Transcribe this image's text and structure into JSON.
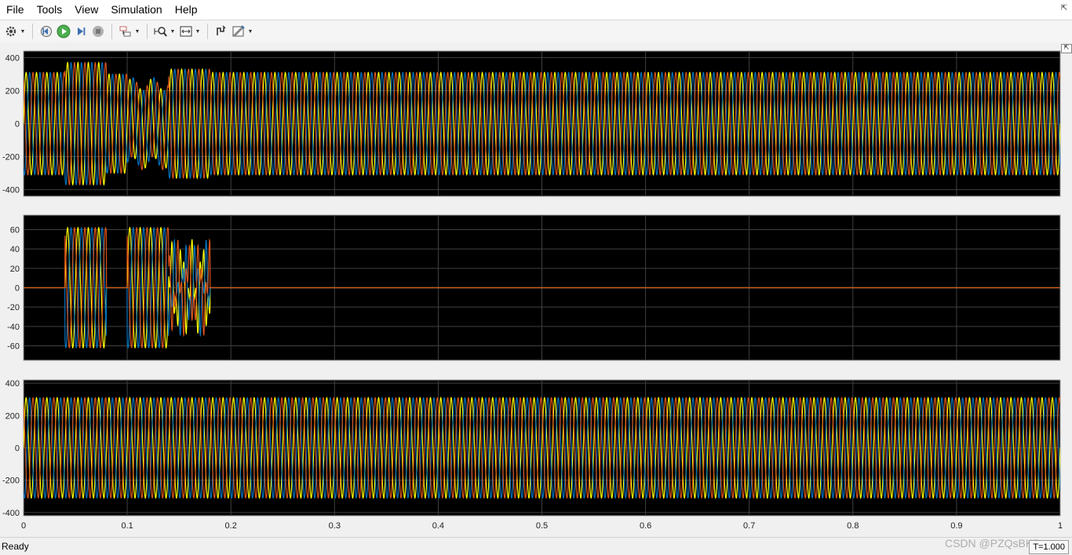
{
  "menubar": {
    "items": [
      {
        "name": "menu-file",
        "label": "File"
      },
      {
        "name": "menu-tools",
        "label": "Tools"
      },
      {
        "name": "menu-view",
        "label": "View"
      },
      {
        "name": "menu-simulation",
        "label": "Simulation"
      },
      {
        "name": "menu-help",
        "label": "Help"
      }
    ]
  },
  "toolbar": {
    "buttons": [
      "configuration-properties-icon",
      "step-back-icon",
      "run-icon",
      "step-forward-icon",
      "stop-icon",
      "highlight-signal-icon",
      "zoom-icon",
      "autoscale-icon",
      "style-icon",
      "cursor-measurements-icon"
    ]
  },
  "status": {
    "text": "Ready",
    "time": "T=1.000"
  },
  "watermark": "CSDN @PZQsBKDawn",
  "colors": {
    "plot_bg": "#000000",
    "grid": "#404040",
    "phase_a": "#ffff00",
    "phase_b": "#0072bd",
    "phase_c": "#d95319"
  },
  "chart_data": [
    {
      "type": "line",
      "title": "",
      "xlabel": "",
      "ylabel": "",
      "xlim": [
        0,
        1
      ],
      "ylim": [
        -440,
        440
      ],
      "yticks": [
        400,
        200,
        0,
        -200,
        -400
      ],
      "grid": true,
      "frequency_hz": 100,
      "series": [
        {
          "phase_deg": 0,
          "color": "#ffff00"
        },
        {
          "phase_deg": -120,
          "color": "#0072bd"
        },
        {
          "phase_deg": 120,
          "color": "#d95319"
        }
      ],
      "segments": [
        {
          "t0": 0.0,
          "t1": 0.04,
          "amplitude": 310
        },
        {
          "t0": 0.04,
          "t1": 0.08,
          "amplitude": 370
        },
        {
          "t0": 0.08,
          "t1": 0.1,
          "amplitude": 300
        },
        {
          "t0": 0.1,
          "t1": 0.14,
          "amplitude": 240
        },
        {
          "t0": 0.14,
          "t1": 0.18,
          "amplitude": 330
        },
        {
          "t0": 0.18,
          "t1": 1.0,
          "amplitude": 310
        }
      ]
    },
    {
      "type": "line",
      "title": "",
      "xlabel": "",
      "ylabel": "",
      "xlim": [
        0,
        1
      ],
      "ylim": [
        -75,
        75
      ],
      "yticks": [
        60,
        40,
        20,
        0,
        -20,
        -40,
        -60
      ],
      "grid": true,
      "frequency_hz": 100,
      "series": [
        {
          "phase_deg": 0,
          "color": "#ffff00"
        },
        {
          "phase_deg": -120,
          "color": "#0072bd"
        },
        {
          "phase_deg": 120,
          "color": "#d95319"
        }
      ],
      "segments": [
        {
          "t0": 0.0,
          "t1": 0.04,
          "amplitude": 0
        },
        {
          "t0": 0.04,
          "t1": 0.08,
          "amplitude": 62
        },
        {
          "t0": 0.08,
          "t1": 0.1,
          "amplitude": 0
        },
        {
          "t0": 0.1,
          "t1": 0.14,
          "amplitude": 62
        },
        {
          "t0": 0.14,
          "t1": 0.18,
          "amplitude": 50
        },
        {
          "t0": 0.18,
          "t1": 1.0,
          "amplitude": 0
        }
      ]
    },
    {
      "type": "line",
      "title": "",
      "xlabel": "",
      "ylabel": "",
      "xlim": [
        0,
        1
      ],
      "ylim": [
        -420,
        420
      ],
      "yticks": [
        400,
        200,
        0,
        -200,
        -400
      ],
      "xticks": [
        0,
        0.1,
        0.2,
        0.3,
        0.4,
        0.5,
        0.6,
        0.7,
        0.8,
        0.9,
        1
      ],
      "xticklabels": [
        "0",
        "0.1",
        "0.2",
        "0.3",
        "0.4",
        "0.5",
        "0.6",
        "0.7",
        "0.8",
        "0.9",
        "1"
      ],
      "grid": true,
      "frequency_hz": 100,
      "series": [
        {
          "phase_deg": 0,
          "color": "#ffff00"
        },
        {
          "phase_deg": -120,
          "color": "#0072bd"
        },
        {
          "phase_deg": 120,
          "color": "#d95319"
        }
      ],
      "segments": [
        {
          "t0": 0.0,
          "t1": 1.0,
          "amplitude": 310
        }
      ]
    }
  ]
}
